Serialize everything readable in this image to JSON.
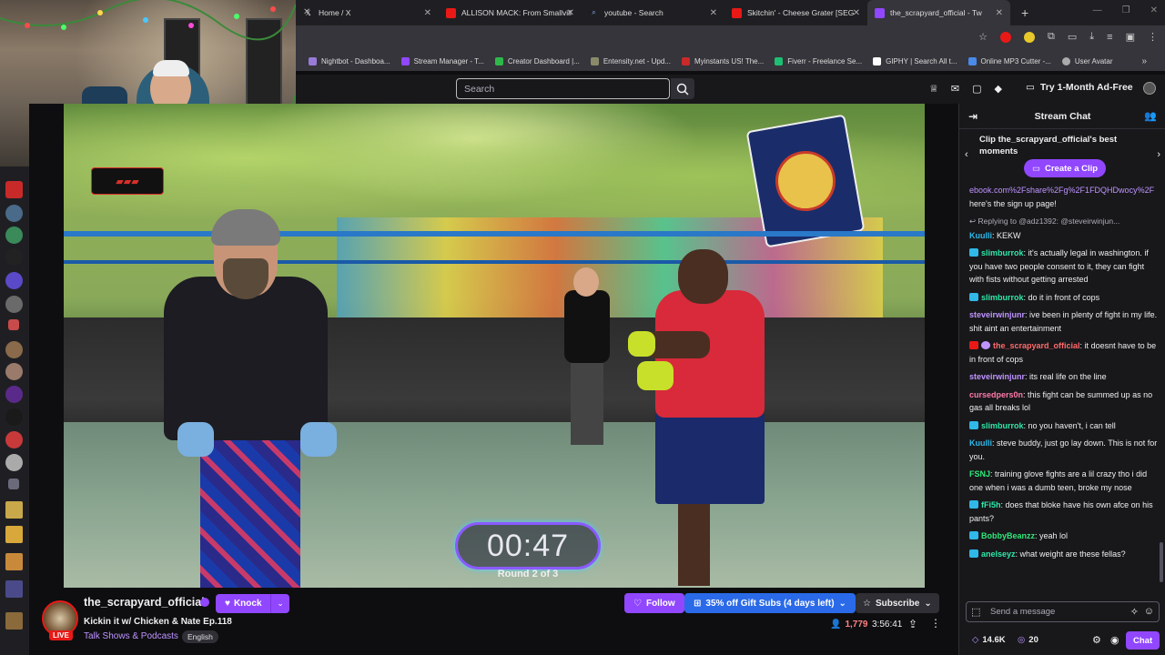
{
  "browser": {
    "tabs": [
      {
        "label": "Home / X",
        "icon": "x-logo-icon"
      },
      {
        "label": "ALLISON MACK: From Smallvill",
        "icon": "youtube-icon"
      },
      {
        "label": "youtube - Search",
        "icon": "search-icon"
      },
      {
        "label": "Skitchin' - Cheese Grater [SEG",
        "icon": "youtube-icon"
      },
      {
        "label": "the_scrapyard_official - Tw",
        "icon": "twitch-icon",
        "active": true
      }
    ],
    "bookmarks": [
      {
        "label": "Nightbot - Dashboa...",
        "color": "#9a7ad8"
      },
      {
        "label": "Stream Manager - T...",
        "color": "#9147ff"
      },
      {
        "label": "Creator Dashboard |...",
        "color": "#2fb84a"
      },
      {
        "label": "Entensity.net - Upd...",
        "color": "#8a8a6a"
      },
      {
        "label": "Myinstants US! The...",
        "color": "#c82a2a"
      },
      {
        "label": "Fiverr - Freelance Se...",
        "color": "#1dbf73"
      },
      {
        "label": "GIPHY | Search All t...",
        "color": "#ffffff"
      },
      {
        "label": "Online MP3 Cutter -...",
        "color": "#4a8ae8"
      },
      {
        "label": "User Avatar",
        "color": "#aaaaaa"
      }
    ]
  },
  "twitch_nav": {
    "search_placeholder": "Search",
    "adfree_label": "Try 1-Month Ad-Free"
  },
  "video": {
    "timer": "00:47",
    "round_label": "Round 2 of 3"
  },
  "stream": {
    "channel": "the_scrapyard_official",
    "knock_label": "Knock",
    "title": "Kickin it w/ Chicken & Nate Ep.118",
    "category": "Talk Shows & Podcasts",
    "tag": "English",
    "live_badge": "LIVE",
    "follow_label": "Follow",
    "gift_subs_label": "35% off Gift Subs (4 days left)",
    "subscribe_label": "Subscribe",
    "viewers": "1,779",
    "uptime": "3:56:41"
  },
  "chat": {
    "header": "Stream Chat",
    "clip_banner": "Clip the_scrapyard_official's best moments",
    "create_clip_label": "Create a Clip",
    "messages": [
      {
        "user": "",
        "color": "#efeff1",
        "text": "",
        "link": "ebook.com%2Fshare%2Fg%2F1FDQHDwocy%2F",
        "tail": " here's the sign up page!"
      },
      {
        "reply": "Replying to @adz1392: @steveirwinjun..."
      },
      {
        "user": "Kuulli",
        "color": "#2fb8e8",
        "text": "KEKW"
      },
      {
        "user": "slimburrok",
        "color": "#2fe8a8",
        "badge": "blue",
        "text": "it's actually legal in washington. if you have two people consent to it, they can fight with fists without getting arrested"
      },
      {
        "user": "slimburrok",
        "color": "#2fe8a8",
        "badge": "blue",
        "text": "do it in front of cops"
      },
      {
        "user": "steveirwinjunr",
        "color": "#bf94ff",
        "text": "ive been in plenty of fight in my life. shit aint an entertainment"
      },
      {
        "user": "the_scrapyard_official",
        "color": "#ff6a6a",
        "badge": "broadcaster",
        "text": "it doesnt have to be in front of cops"
      },
      {
        "user": "steveirwinjunr",
        "color": "#bf94ff",
        "text": "its real life on the line"
      },
      {
        "user": "cursedpers0n",
        "color": "#ff7aa8",
        "text": "this fight can be summed up as no gas all breaks lol"
      },
      {
        "user": "slimburrok",
        "color": "#2fe8a8",
        "badge": "blue",
        "text": "no you haven't, i can tell"
      },
      {
        "user": "Kuulli",
        "color": "#2fb8e8",
        "text": "steve buddy, just go lay down. This is not for you."
      },
      {
        "user": "FSNJ",
        "color": "#2fe87a",
        "text": "training glove fights are a lil crazy tho i did one when i was a dumb teen, broke my nose"
      },
      {
        "user": "fFi5h",
        "color": "#2fe8a8",
        "badge": "blue",
        "text": "does that bloke have his own afce on his pants?"
      },
      {
        "user": "BobbyBeanzz",
        "color": "#2fe87a",
        "badge": "blue",
        "text": "yeah lol"
      },
      {
        "user": "anelseyz",
        "color": "#2fe8a8",
        "badge": "blue",
        "text": "what weight are these fellas?"
      }
    ],
    "input_placeholder": "Send a message",
    "points": "14.6K",
    "bits": "20",
    "chat_button": "Chat"
  }
}
